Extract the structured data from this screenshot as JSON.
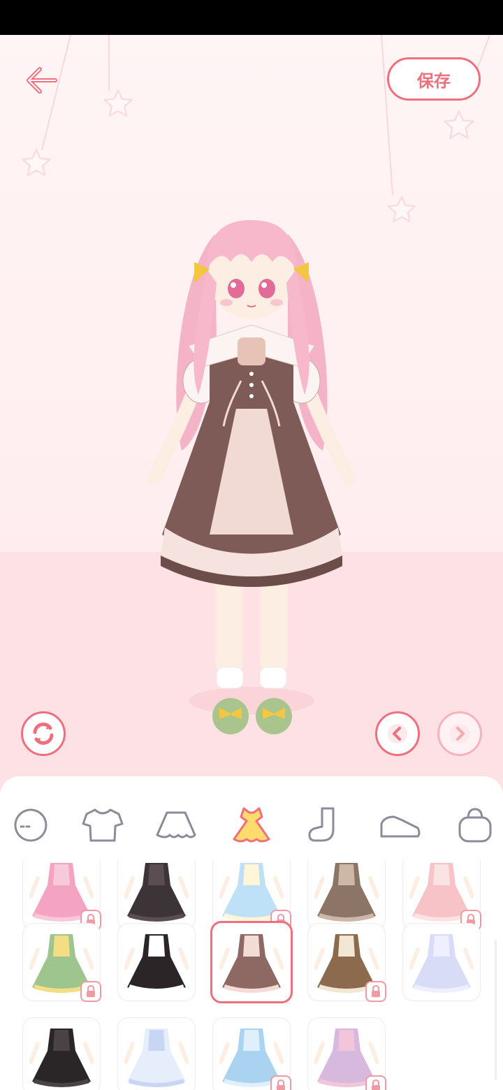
{
  "header": {
    "save_label": "保存"
  },
  "icons": {
    "back": "back-arrow-icon",
    "shuffle": "shuffle-icon",
    "prev": "chevron-left-icon",
    "next": "chevron-right-icon",
    "lock": "lock-icon"
  },
  "category_tabs": [
    {
      "name": "face",
      "icon": "face-icon"
    },
    {
      "name": "top",
      "icon": "tshirt-icon"
    },
    {
      "name": "skirt",
      "icon": "skirt-icon"
    },
    {
      "name": "dress",
      "icon": "dress-icon",
      "active": true
    },
    {
      "name": "socks",
      "icon": "sock-icon"
    },
    {
      "name": "shoes",
      "icon": "shoe-icon"
    },
    {
      "name": "bag",
      "icon": "bag-icon"
    }
  ],
  "outfits": [
    {
      "row": 0,
      "col": 0,
      "color": "#f5a3c3",
      "accent": "#f8c9d9",
      "locked": true
    },
    {
      "row": 0,
      "col": 1,
      "color": "#3d3438",
      "accent": "#5a4e53",
      "locked": false
    },
    {
      "row": 0,
      "col": 2,
      "color": "#bfe1f7",
      "accent": "#fff6d8",
      "locked": true
    },
    {
      "row": 0,
      "col": 3,
      "color": "#8c7467",
      "accent": "#cdb7a6",
      "locked": false
    },
    {
      "row": 0,
      "col": 4,
      "color": "#f7c3c6",
      "accent": "#fbe2e3",
      "locked": true
    },
    {
      "row": 1,
      "col": 0,
      "color": "#9fc58e",
      "accent": "#f3dd85",
      "locked": true
    },
    {
      "row": 1,
      "col": 1,
      "color": "#2b2527",
      "accent": "#ffffff",
      "locked": false
    },
    {
      "row": 1,
      "col": 2,
      "color": "#8e6863",
      "accent": "#f3dbd6",
      "locked": false,
      "selected": true
    },
    {
      "row": 1,
      "col": 3,
      "color": "#8b6a4e",
      "accent": "#f2e6d4",
      "locked": true
    },
    {
      "row": 1,
      "col": 4,
      "color": "#d9dcf6",
      "accent": "#eef0ff",
      "locked": false
    },
    {
      "row": 2,
      "col": 0,
      "color": "#2a2627",
      "accent": "#4a4346",
      "locked": false
    },
    {
      "row": 2,
      "col": 1,
      "color": "#e6eefc",
      "accent": "#c8d6f3",
      "locked": false
    },
    {
      "row": 2,
      "col": 2,
      "color": "#a9d3f0",
      "accent": "#e0f0fb",
      "locked": true
    },
    {
      "row": 2,
      "col": 3,
      "color": "#d8b9de",
      "accent": "#f2c5da",
      "locked": true
    }
  ],
  "colors": {
    "accent": "#ef6f7c",
    "hair": "#f7b8cc",
    "dress_main": "#7e5b57",
    "dress_light": "#f1d9d4",
    "ribbon": "#f5c63f",
    "shoes": "#a9c48c"
  }
}
